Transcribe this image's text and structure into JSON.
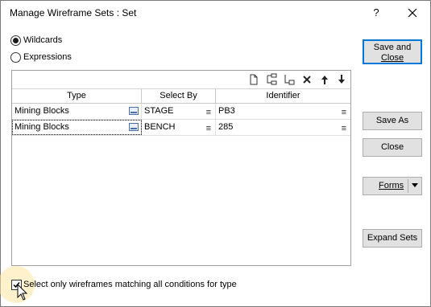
{
  "window": {
    "title": "Manage Wireframe Sets : Set",
    "help_glyph": "?"
  },
  "mode_options": [
    {
      "label": "Wildcards",
      "selected": true
    },
    {
      "label": "Expressions",
      "selected": false
    }
  ],
  "grid": {
    "toolbar_icons": [
      "new-row-icon",
      "insert-row-icon",
      "insert-after-icon",
      "delete-icon",
      "move-up-icon",
      "move-down-icon"
    ],
    "columns": [
      "Type",
      "Select By",
      "Identifier"
    ],
    "rows": [
      {
        "type": "Mining Blocks",
        "select_by": "STAGE",
        "identifier": "PB3"
      },
      {
        "type": "Mining Blocks",
        "select_by": "BENCH",
        "identifier": "285"
      }
    ]
  },
  "buttons": {
    "save_and_close_line1": "Save and",
    "save_and_close_line2": "Close",
    "save_as": "Save As",
    "close": "Close",
    "forms": "Forms",
    "expand_sets": "Expand Sets"
  },
  "match_all": {
    "label": "Select only wireframes matching all conditions for type",
    "checked": true
  },
  "colors": {
    "accent": "#0078d7",
    "button_face": "#e1e1e1"
  }
}
